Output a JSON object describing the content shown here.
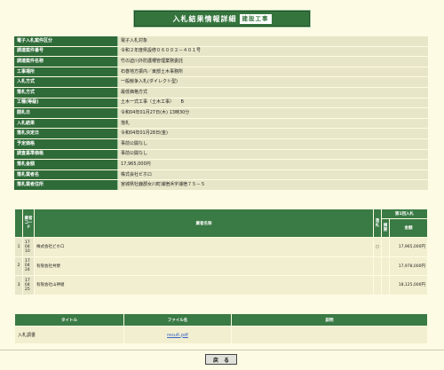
{
  "page": {
    "title": "入札結果情報詳細",
    "title_tag": "建設工事",
    "back_label": "戻　る"
  },
  "info_rows": [
    {
      "label": "電子入札案件区分",
      "value": "電子入札対象"
    },
    {
      "label": "調達案件番号",
      "value": "令和２年度県設修０６００２－４０１号"
    },
    {
      "label": "調達案件名称",
      "value": "竹の迫川外防護柵管理業務委託"
    },
    {
      "label": "工事場所",
      "value": "石巻地方振内／東部土木事務所"
    },
    {
      "label": "入札方式",
      "value": "一般競争入札(ダイレクト型)"
    },
    {
      "label": "落札方式",
      "value": "最低価格方式"
    },
    {
      "label": "工種(等級)",
      "value": "土木一式工事（土木工事）　　B"
    },
    {
      "label": "開札日",
      "value": "令和04年01月27日(木) 13時30分"
    },
    {
      "label": "入札結果",
      "value": "落札"
    },
    {
      "label": "落札決定日",
      "value": "令和04年01月28日(金)"
    },
    {
      "label": "予定価格",
      "value": "事前公開なし"
    },
    {
      "label": "調査基準価格",
      "value": "事前公開なし"
    },
    {
      "label": "落札金額",
      "value": "17,965,000円"
    },
    {
      "label": "落札業者名",
      "value": "株式会社ビホロ"
    },
    {
      "label": "落札業者住所",
      "value": "宮城県牡鹿郡女川町浦宿浜字浦宿７５－５"
    }
  ],
  "bids_table": {
    "headers": {
      "num": "",
      "code": "業者コード",
      "name": "業者名称",
      "result": "落札",
      "first_round": "第1回入札",
      "remarks": "摘要",
      "amount": "金額"
    },
    "rows": [
      {
        "num": "1",
        "code": "17\n04\n10",
        "name": "株式会社ビホロ",
        "mark": "○",
        "amount": "17,965,000円"
      },
      {
        "num": "2",
        "code": "17\n04\n24",
        "name": "有限会社共榮",
        "mark": "",
        "amount": "17,978,000円"
      },
      {
        "num": "3",
        "code": "17\n04\n25",
        "name": "有限会社山神組",
        "mark": "",
        "amount": "18,125,000円"
      }
    ]
  },
  "docs_table": {
    "headers": {
      "title": "タイトル",
      "file": "ファイル名",
      "note": "説明"
    },
    "rows": [
      {
        "title": "入札調書",
        "file": "result.pdf",
        "note": ""
      }
    ]
  }
}
